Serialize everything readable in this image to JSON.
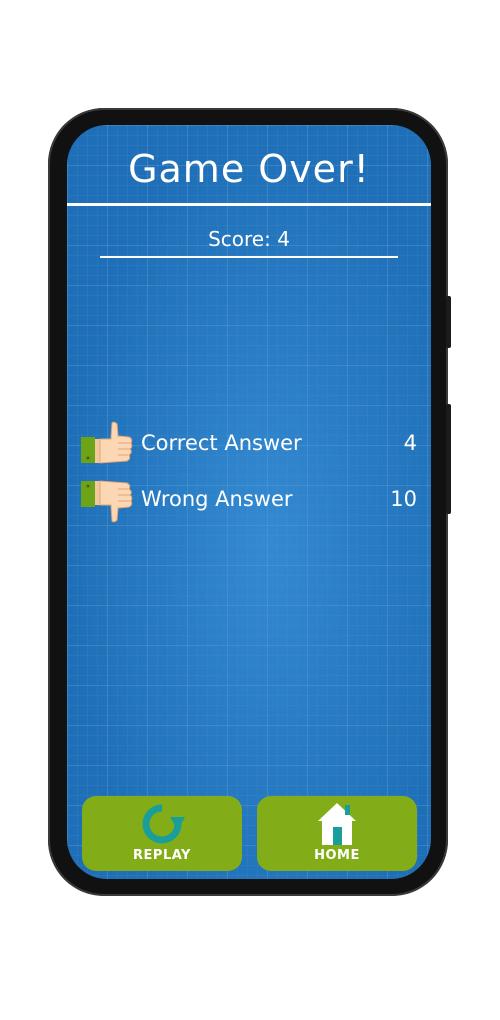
{
  "header": {
    "title": "Game Over!",
    "score_text": "Score: 4"
  },
  "stats": {
    "correct": {
      "label": "Correct Answer",
      "value": "4",
      "icon": "thumbs-up-icon"
    },
    "wrong": {
      "label": "Wrong Answer",
      "value": "10",
      "icon": "thumbs-down-icon"
    }
  },
  "buttons": {
    "replay": {
      "label": "REPLAY",
      "icon": "replay-icon"
    },
    "home": {
      "label": "HOME",
      "icon": "home-icon"
    }
  },
  "colors": {
    "background": "#1e6fb7",
    "button": "#82ad18",
    "text": "#ffffff"
  }
}
